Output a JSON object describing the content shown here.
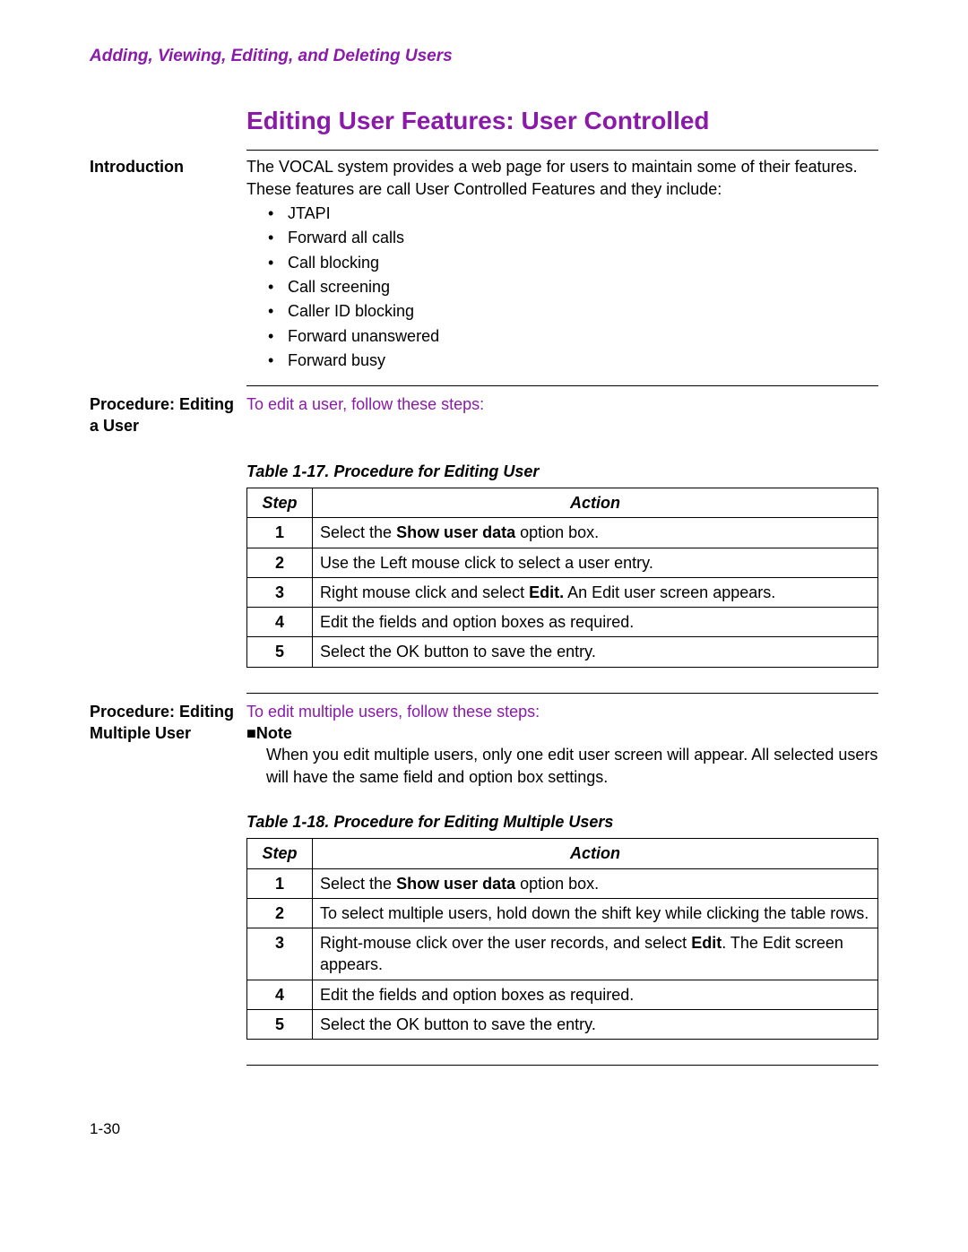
{
  "section_header": "Adding, Viewing, Editing, and Deleting Users",
  "title": "Editing User Features: User Controlled",
  "intro": {
    "label": "Introduction",
    "text": "The VOCAL system provides a web page for users to maintain some of their features. These features are call User Controlled Features and they include:",
    "features": [
      "JTAPI",
      "Forward all calls",
      "Call blocking",
      "Call screening",
      "Caller ID blocking",
      "Forward unanswered",
      "Forward busy"
    ]
  },
  "edit_user": {
    "label": "Procedure: Editing a User",
    "steps_line": "To edit a user, follow these steps:"
  },
  "table1": {
    "caption": "Table 1-17. Procedure for Editing User",
    "head_step": "Step",
    "head_action": "Action",
    "rows": [
      {
        "n": "1",
        "pre": "Select the ",
        "bold": "Show user data",
        "post": " option box."
      },
      {
        "n": "2",
        "pre": "Use the Left mouse click to select a user entry.",
        "bold": "",
        "post": ""
      },
      {
        "n": "3",
        "pre": "Right mouse click and select ",
        "bold": "Edit.",
        "post": " An Edit user screen appears."
      },
      {
        "n": "4",
        "pre": "Edit the fields and option boxes as required.",
        "bold": "",
        "post": ""
      },
      {
        "n": "5",
        "pre": "Select the OK button to save the entry.",
        "bold": "",
        "post": ""
      }
    ]
  },
  "edit_multi": {
    "label": "Procedure: Editing Multiple User",
    "steps_line": "To edit multiple users, follow these steps:",
    "note_label": "Note",
    "note_text": "When you edit multiple users, only one edit user screen will appear. All selected users will have the same field and option box settings."
  },
  "table2": {
    "caption": "Table 1-18. Procedure for Editing Multiple Users",
    "head_step": "Step",
    "head_action": "Action",
    "rows": [
      {
        "n": "1",
        "pre": "Select the ",
        "bold": "Show user data",
        "post": " option box."
      },
      {
        "n": "2",
        "pre": "To select multiple users, hold down the shift key while clicking the table rows.",
        "bold": "",
        "post": ""
      },
      {
        "n": "3",
        "pre": "Right-mouse click over the user records, and select ",
        "bold": "Edit",
        "post": ". The Edit screen appears."
      },
      {
        "n": "4",
        "pre": "Edit the fields and option boxes as required.",
        "bold": "",
        "post": ""
      },
      {
        "n": "5",
        "pre": "Select the OK button to save the entry.",
        "bold": "",
        "post": ""
      }
    ]
  },
  "page_number": "1-30"
}
